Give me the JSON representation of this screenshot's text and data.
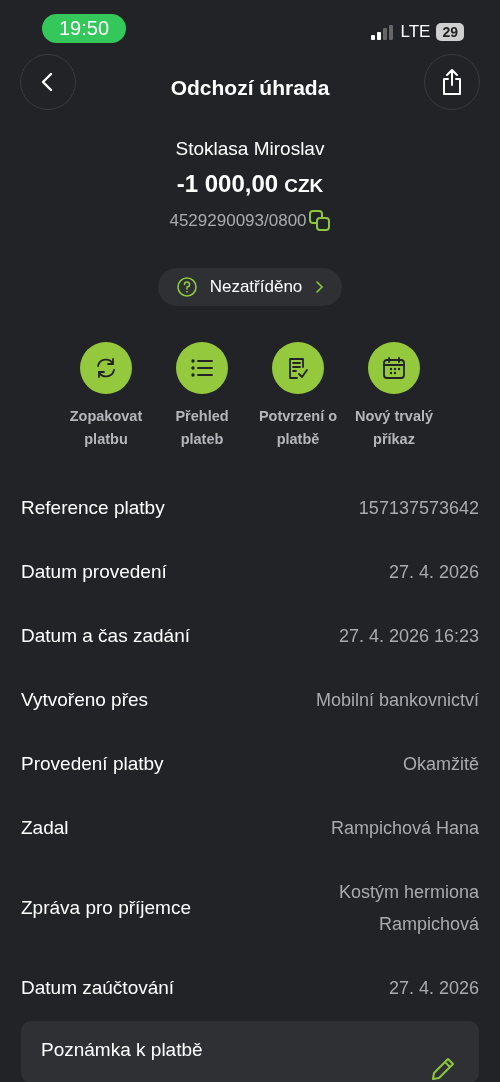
{
  "status_bar": {
    "time": "19:50",
    "network": "LTE",
    "battery": "29"
  },
  "header": {
    "title": "Odchozí úhrada"
  },
  "payment": {
    "counterparty": "Stoklasa Miroslav",
    "amount": "-1 000,00",
    "currency": "CZK",
    "account": "4529290093/0800"
  },
  "category": {
    "label": "Nezatříděno"
  },
  "actions": [
    {
      "kind": "repeat",
      "label": "Zopakovat platbu"
    },
    {
      "kind": "list",
      "label": "Přehled plateb"
    },
    {
      "kind": "confirmation",
      "label": "Potvrzení o platbě"
    },
    {
      "kind": "calendar",
      "label": "Nový trvalý příkaz"
    }
  ],
  "details": [
    {
      "label": "Reference platby",
      "value": "157137573642"
    },
    {
      "label": "Datum provedení",
      "value": "27. 4. 2026"
    },
    {
      "label": "Datum a čas zadání",
      "value": "27. 4. 2026 16:23"
    },
    {
      "label": "Vytvořeno přes",
      "value": "Mobilní bankovnictví"
    },
    {
      "label": "Provedení platby",
      "value": "Okamžitě"
    },
    {
      "label": "Zadal",
      "value": "Rampichová Hana"
    },
    {
      "label": "Zpráva pro příjemce",
      "value": "Kostým hermiona Rampichová"
    },
    {
      "label": "Datum zaúčtování",
      "value": "27. 4. 2026"
    }
  ],
  "note": {
    "title": "Poznámka k platbě"
  }
}
